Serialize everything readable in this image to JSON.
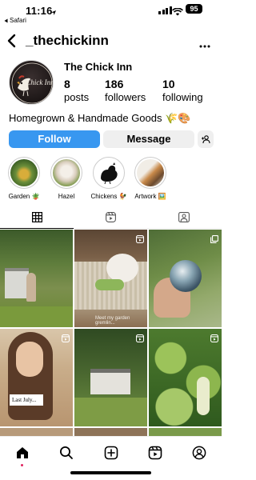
{
  "status_bar": {
    "time": "11:16",
    "back_app": "Safari",
    "battery": "95"
  },
  "header": {
    "username": "_thechickinn"
  },
  "profile": {
    "display_name": "The Chick Inn",
    "avatar_text": "Chick Inn",
    "stats": [
      {
        "value": "8",
        "label": "posts"
      },
      {
        "value": "186",
        "label": "followers"
      },
      {
        "value": "10",
        "label": "following"
      }
    ],
    "bio": "Homegrown & Handmade Goods 🌾🎨"
  },
  "actions": {
    "follow_label": "Follow",
    "message_label": "Message"
  },
  "highlights": [
    {
      "label": "Garden 🪴",
      "icon": "garden-highlight"
    },
    {
      "label": "Hazel",
      "icon": "hazel-highlight"
    },
    {
      "label": "Chickens 🐓",
      "icon": "chickens-highlight"
    },
    {
      "label": "Artwork 🖼️",
      "icon": "artwork-highlight"
    }
  ],
  "posts": [
    {
      "caption": "",
      "type": "photo"
    },
    {
      "caption": "",
      "type": "reel"
    },
    {
      "caption": "",
      "type": "carousel"
    },
    {
      "caption": "Last July...",
      "type": "reel"
    },
    {
      "caption": "",
      "type": "reel"
    },
    {
      "caption": "",
      "type": "reel"
    }
  ],
  "post_overlay_text": "Meet my garden gremlin...",
  "colors": {
    "follow_blue": "#3897f0",
    "button_gray": "#efefef",
    "notification_red": "#e0245e"
  }
}
